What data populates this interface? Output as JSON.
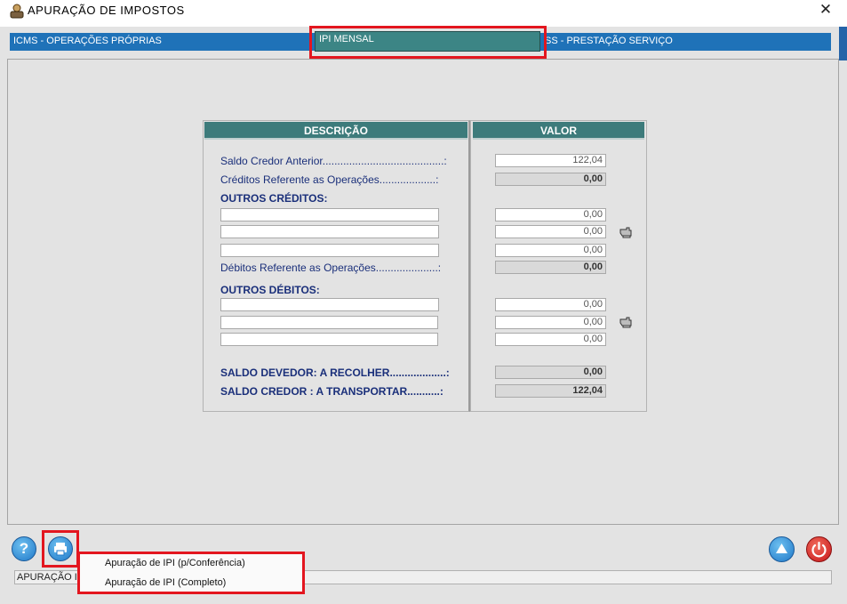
{
  "window": {
    "title": "APURAÇÃO  DE  IMPOSTOS",
    "close_label": "✕"
  },
  "tabs": {
    "icms": "ICMS - OPERAÇÕES PRÓPRIAS",
    "ipi": "IPI  MENSAL",
    "iss": "SS - PRESTAÇÃO SERVIÇO"
  },
  "table": {
    "header_descricao": "DESCRIÇÃO",
    "header_valor": "VALOR",
    "saldo_credor_anterior_label": "Saldo Credor Anterior.........................................:",
    "saldo_credor_anterior_value": "122,04",
    "creditos_label": "Créditos Referente as Operações...................:",
    "creditos_value": "0,00",
    "outros_creditos_label": "OUTROS CRÉDITOS:",
    "outros_creditos_values": [
      "0,00",
      "0,00",
      "0,00"
    ],
    "debitos_label": "Débitos Referente as Operações.....................:",
    "debitos_value": "0,00",
    "outros_debitos_label": "OUTROS DÉBITOS:",
    "outros_debitos_values": [
      "0,00",
      "0,00",
      "0,00"
    ],
    "saldo_devedor_label": "SALDO DEVEDOR:  A  RECOLHER...................:",
    "saldo_devedor_value": "0,00",
    "saldo_credor_label": "SALDO CREDOR  :  A  TRANSPORTAR...........:",
    "saldo_credor_value": "122,04"
  },
  "bottom": {
    "help_label": "?",
    "status_text": "APURAÇÃO I"
  },
  "print_menu": {
    "items": [
      "Apuração de IPI (p/Conferência)",
      "Apuração de IPI (Completo)"
    ]
  },
  "colors": {
    "accent_teal": "#3d7b7b",
    "tab_blue": "#1f72b8",
    "highlight_red": "#e3161f",
    "label_navy": "#1a2f7a"
  }
}
